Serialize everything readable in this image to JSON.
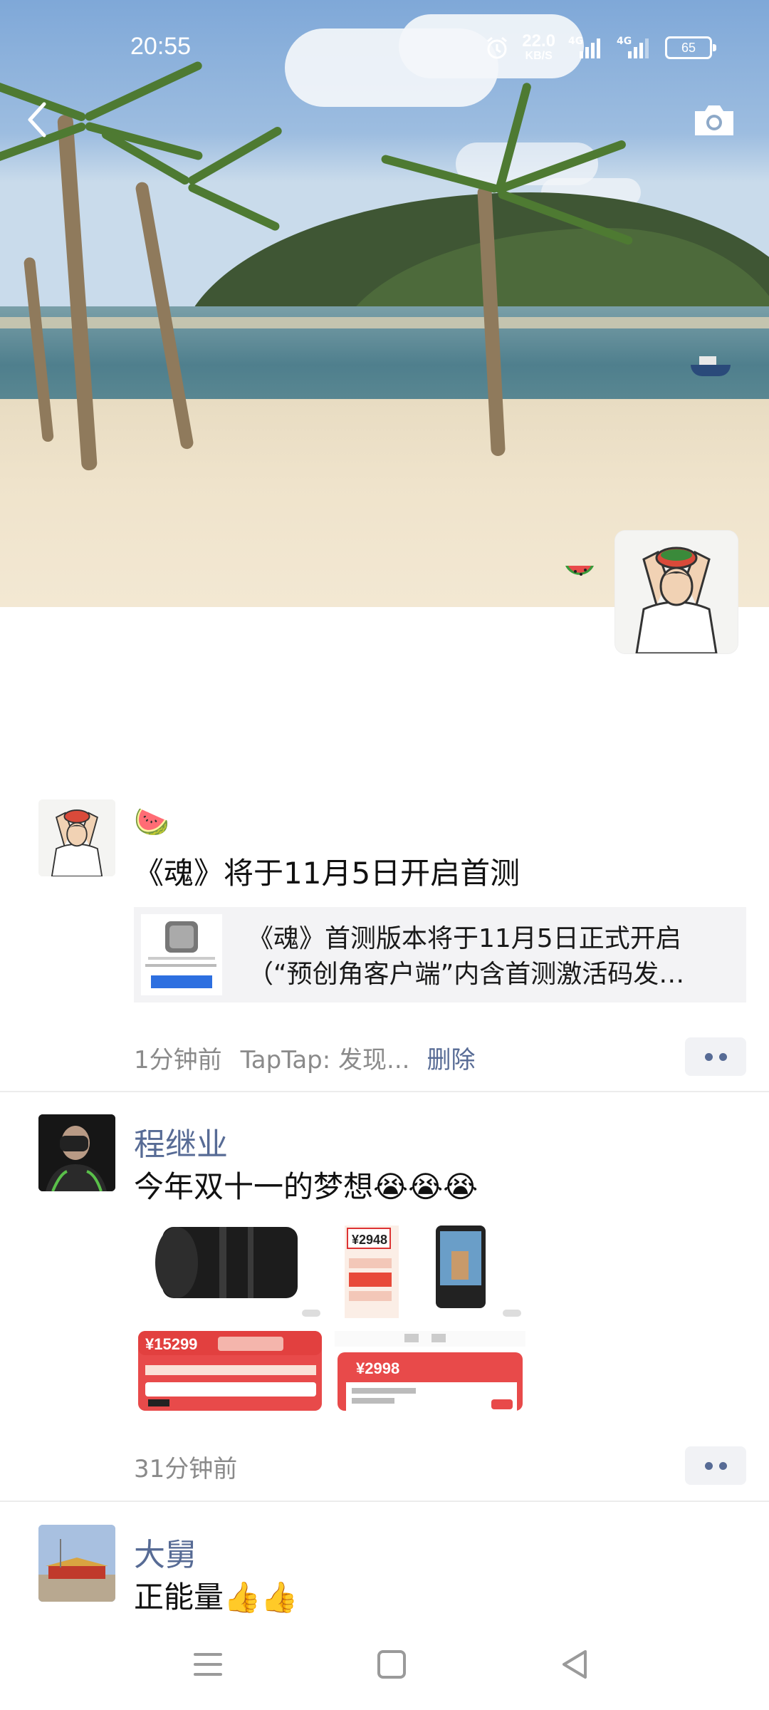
{
  "status_bar": {
    "time": "20:55",
    "net_speed_value": "22.0",
    "net_speed_unit": "KB/S",
    "signal_1_label": "4G",
    "signal_2_label": "4G",
    "battery": "65"
  },
  "header": {
    "back_icon": "chevron-left-icon",
    "camera_icon": "camera-icon"
  },
  "posts": [
    {
      "emoji": "🍉",
      "text": "《魂》将于11月5日开启首测",
      "link_card": {
        "line1": "《魂》首测版本将于11月5日正式开启",
        "line2": "（“预创角客户端”内含首测激活码发…"
      },
      "time": "1分钟前",
      "source": "TapTap: 发现...",
      "delete_label": "删除"
    },
    {
      "username": "程继业",
      "text": "今年双十一的梦想😭😭😭",
      "time": "31分钟前",
      "images": [
        {
          "price_text": ""
        },
        {
          "price_text": "¥2948"
        },
        {
          "price_text": ""
        },
        {
          "price_text": "¥15299"
        },
        {
          "price_text": "¥2998"
        }
      ]
    },
    {
      "username": "大舅",
      "text": "正能量👍👍"
    }
  ],
  "nav_bar": {
    "menu_icon": "menu-icon",
    "home_icon": "home-square-icon",
    "back_icon": "back-triangle-icon"
  },
  "colors": {
    "username": "#576b95",
    "meta_gray": "#8a8a8a",
    "card_bg": "#f3f3f5"
  }
}
